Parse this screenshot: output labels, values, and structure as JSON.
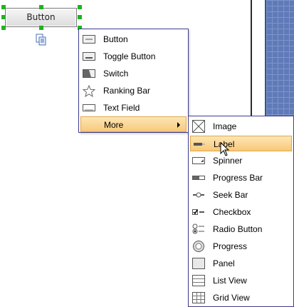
{
  "canvas": {
    "selected_widget_label": "Button"
  },
  "context_menu": {
    "items": [
      {
        "label": "Button",
        "icon": "button-icon"
      },
      {
        "label": "Toggle Button",
        "icon": "toggle-button-icon"
      },
      {
        "label": "Switch",
        "icon": "switch-icon"
      },
      {
        "label": "Ranking Bar",
        "icon": "star-icon"
      },
      {
        "label": "Text Field",
        "icon": "text-field-icon"
      },
      {
        "label": "More",
        "icon": "",
        "has_submenu": true,
        "highlighted": true
      }
    ]
  },
  "more_submenu": {
    "items": [
      {
        "label": "Image",
        "icon": "image-icon"
      },
      {
        "label": "Label",
        "icon": "label-icon",
        "highlighted": true
      },
      {
        "label": "Spinner",
        "icon": "spinner-icon"
      },
      {
        "label": "Progress Bar",
        "icon": "progress-bar-icon"
      },
      {
        "label": "Seek Bar",
        "icon": "seek-bar-icon"
      },
      {
        "label": "Checkbox",
        "icon": "checkbox-icon"
      },
      {
        "label": "Radio Button",
        "icon": "radio-button-icon"
      },
      {
        "label": "Progress",
        "icon": "progress-icon"
      },
      {
        "label": "Panel",
        "icon": "panel-icon"
      },
      {
        "label": "List View",
        "icon": "list-view-icon"
      },
      {
        "label": "Grid View",
        "icon": "grid-view-icon"
      }
    ]
  },
  "colors": {
    "highlight": "#f8c97a",
    "menu_border": "#3b3b8f",
    "handle": "#1fb31f",
    "canvas_right": "#5f7ab8"
  }
}
